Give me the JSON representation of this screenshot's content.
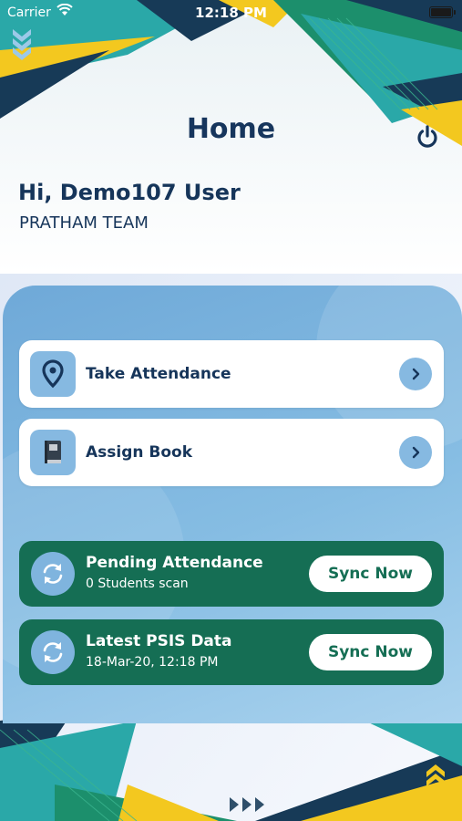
{
  "status_bar": {
    "carrier": "Carrier",
    "time": "12:18 PM"
  },
  "header": {
    "title": "Home",
    "power_icon": "power-icon"
  },
  "user": {
    "greeting": "Hi, Demo107 User",
    "team": "PRATHAM TEAM"
  },
  "menu": [
    {
      "label": "Take Attendance",
      "icon": "location-pin-icon"
    },
    {
      "label": "Assign Book",
      "icon": "book-icon"
    }
  ],
  "sync": [
    {
      "title": "Pending Attendance",
      "subtitle": "0 Students scan",
      "button": "Sync Now",
      "icon": "sync-icon"
    },
    {
      "title": "Latest PSIS Data",
      "subtitle": "18-Mar-20, 12:18 PM",
      "button": "Sync Now",
      "icon": "sync-icon"
    }
  ],
  "colors": {
    "title": "#17365d",
    "sync_card": "#156e54",
    "accent_blue": "#86b9e1",
    "accent_yellow": "#f3c81f",
    "accent_teal": "#1fa3a0"
  }
}
